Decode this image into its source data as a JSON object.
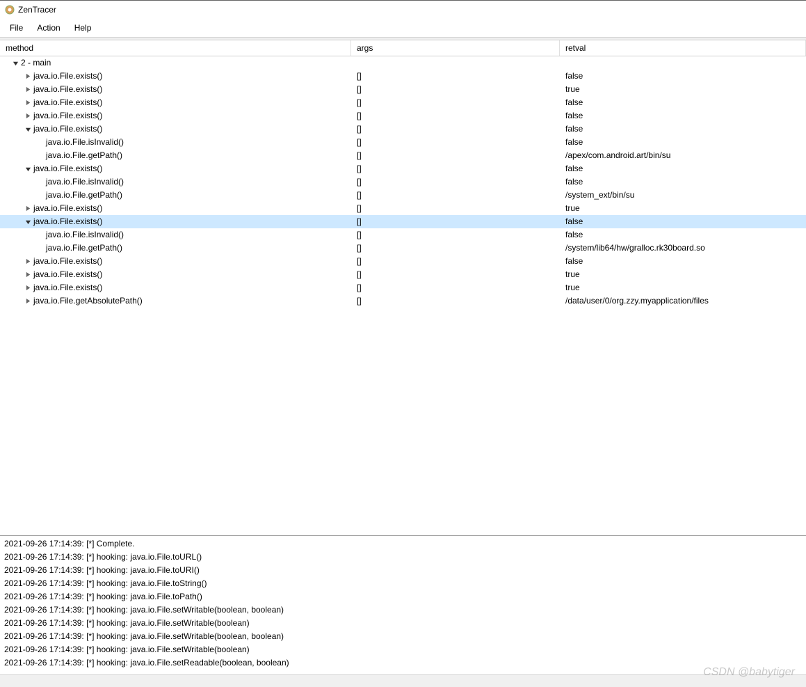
{
  "app": {
    "title": "ZenTracer"
  },
  "menu": {
    "file": "File",
    "action": "Action",
    "help": "Help"
  },
  "columns": {
    "method": "method",
    "args": "args",
    "retval": "retval"
  },
  "tree": [
    {
      "depth": 0,
      "exp": "open",
      "method": "2 - main",
      "args": "",
      "retval": ""
    },
    {
      "depth": 1,
      "exp": "closed",
      "method": "java.io.File.exists()",
      "args": "[]",
      "retval": "false"
    },
    {
      "depth": 1,
      "exp": "closed",
      "method": "java.io.File.exists()",
      "args": "[]",
      "retval": "true"
    },
    {
      "depth": 1,
      "exp": "closed",
      "method": "java.io.File.exists()",
      "args": "[]",
      "retval": "false"
    },
    {
      "depth": 1,
      "exp": "closed",
      "method": "java.io.File.exists()",
      "args": "[]",
      "retval": "false"
    },
    {
      "depth": 1,
      "exp": "open",
      "method": "java.io.File.exists()",
      "args": "[]",
      "retval": "false"
    },
    {
      "depth": 2,
      "exp": "none",
      "method": "java.io.File.isInvalid()",
      "args": "[]",
      "retval": "false"
    },
    {
      "depth": 2,
      "exp": "none",
      "method": "java.io.File.getPath()",
      "args": "[]",
      "retval": "/apex/com.android.art/bin/su"
    },
    {
      "depth": 1,
      "exp": "open",
      "method": "java.io.File.exists()",
      "args": "[]",
      "retval": "false"
    },
    {
      "depth": 2,
      "exp": "none",
      "method": "java.io.File.isInvalid()",
      "args": "[]",
      "retval": "false"
    },
    {
      "depth": 2,
      "exp": "none",
      "method": "java.io.File.getPath()",
      "args": "[]",
      "retval": "/system_ext/bin/su"
    },
    {
      "depth": 1,
      "exp": "closed",
      "method": "java.io.File.exists()",
      "args": "[]",
      "retval": "true"
    },
    {
      "depth": 1,
      "exp": "open",
      "method": "java.io.File.exists()",
      "args": "[]",
      "retval": "false",
      "selected": true
    },
    {
      "depth": 2,
      "exp": "none",
      "method": "java.io.File.isInvalid()",
      "args": "[]",
      "retval": "false"
    },
    {
      "depth": 2,
      "exp": "none",
      "method": "java.io.File.getPath()",
      "args": "[]",
      "retval": "/system/lib64/hw/gralloc.rk30board.so"
    },
    {
      "depth": 1,
      "exp": "closed",
      "method": "java.io.File.exists()",
      "args": "[]",
      "retval": "false"
    },
    {
      "depth": 1,
      "exp": "closed",
      "method": "java.io.File.exists()",
      "args": "[]",
      "retval": "true"
    },
    {
      "depth": 1,
      "exp": "closed",
      "method": "java.io.File.exists()",
      "args": "[]",
      "retval": "true"
    },
    {
      "depth": 1,
      "exp": "closed",
      "method": "java.io.File.getAbsolutePath()",
      "args": "[]",
      "retval": "/data/user/0/org.zzy.myapplication/files"
    }
  ],
  "log": [
    "2021-09-26 17:14:39:  [*] Complete.",
    "2021-09-26 17:14:39:  [*] hooking: java.io.File.toURL()",
    "2021-09-26 17:14:39:  [*] hooking: java.io.File.toURI()",
    "2021-09-26 17:14:39:  [*] hooking: java.io.File.toString()",
    "2021-09-26 17:14:39:  [*] hooking: java.io.File.toPath()",
    "2021-09-26 17:14:39:  [*] hooking: java.io.File.setWritable(boolean, boolean)",
    "2021-09-26 17:14:39:  [*] hooking: java.io.File.setWritable(boolean)",
    "2021-09-26 17:14:39:  [*] hooking: java.io.File.setWritable(boolean, boolean)",
    "2021-09-26 17:14:39:  [*] hooking: java.io.File.setWritable(boolean)",
    "2021-09-26 17:14:39:  [*] hooking: java.io.File.setReadable(boolean, boolean)"
  ],
  "watermark": "CSDN @babytiger"
}
